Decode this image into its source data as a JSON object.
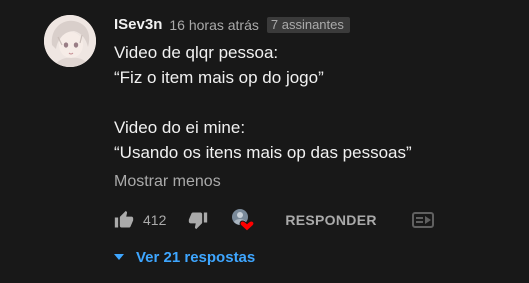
{
  "comment": {
    "author": "ISev3n",
    "time": "16 horas atrás",
    "subscribers_badge": "7 assinantes",
    "lines": [
      "Video de qlqr pessoa:",
      "“Fiz o item mais op do jogo”",
      "",
      "Video do ei mine:",
      "“Usando os itens mais op das pessoas”"
    ],
    "show_less": "Mostrar menos",
    "like_count": "412",
    "reply_label": "RESPONDER",
    "view_replies": "Ver 21 respostas"
  },
  "icons": {
    "like": "thumbs-up-icon",
    "dislike": "thumbs-down-icon",
    "creator_heart": "creator-heart-icon",
    "more": "overflow-icon",
    "expand": "caret-down-icon"
  },
  "colors": {
    "background": "#181818",
    "text": "#f1f1f1",
    "secondary": "#aaaaaa",
    "link": "#3ea6ff",
    "heart": "#ff0000"
  }
}
